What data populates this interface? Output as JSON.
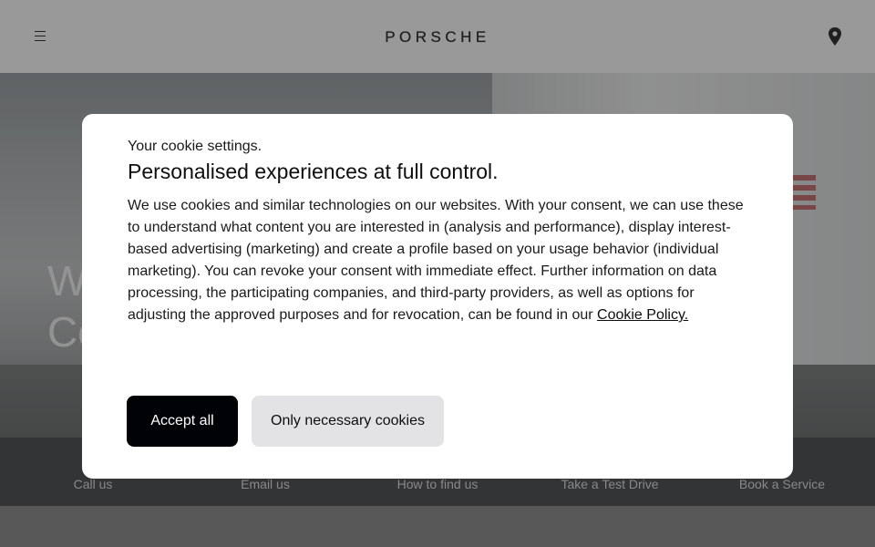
{
  "header": {
    "brand": "PORSCHE",
    "menu_icon": "hamburger-menu-icon",
    "location_icon": "location-pin-icon"
  },
  "hero": {
    "title_line1": "W",
    "title_line2": "Co"
  },
  "quick_links": [
    {
      "label": "Call us"
    },
    {
      "label": "Email us"
    },
    {
      "label": "How to find us"
    },
    {
      "label": "Take a Test Drive"
    },
    {
      "label": "Book a Service"
    }
  ],
  "cookie_dialog": {
    "kicker": "Your cookie settings.",
    "title": "Personalised experiences at full control.",
    "body": "We use cookies and similar technologies on our websites. With your consent, we can use these to understand what content you are interested in (analysis and performance), display interest-based advertising (marketing) and create a profile based on your usage behavior (individual marketing). You can revoke your consent with immediate effect. Further information on data processing, the participating companies, and third-party providers, as well as options for adjusting the approved purposes and for revocation, can be found in our ",
    "policy_link": "Cookie Policy.",
    "accept_label": "Accept all",
    "necessary_label": "Only necessary cookies"
  },
  "colors": {
    "accept_bg": "#010205",
    "secondary_bg": "#e3e3e5",
    "header_bg": "#f6f6f6",
    "quicklinks_bg": "#3b3e40"
  }
}
